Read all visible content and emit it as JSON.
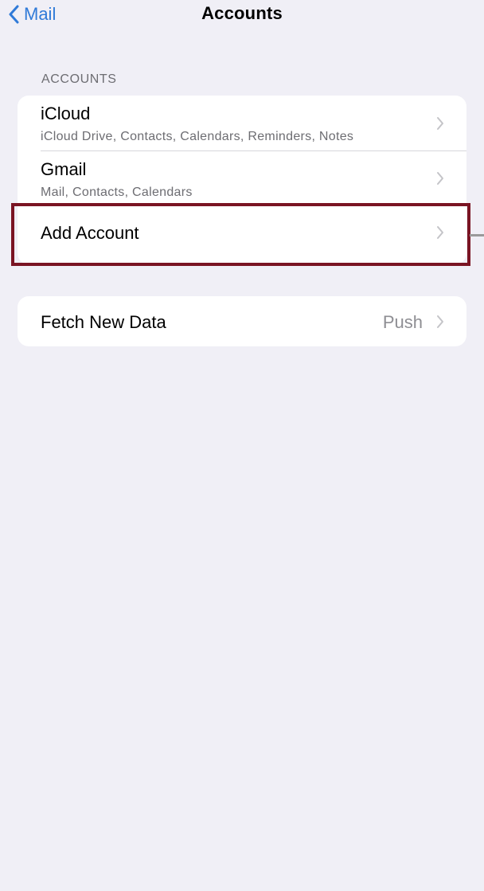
{
  "nav": {
    "back_label": "Mail",
    "title": "Accounts"
  },
  "accounts_section": {
    "header": "ACCOUNTS",
    "items": [
      {
        "title": "iCloud",
        "subtitle": "iCloud Drive, Contacts, Calendars, Reminders, Notes"
      },
      {
        "title": "Gmail",
        "subtitle": "Mail, Contacts, Calendars"
      },
      {
        "title": "Add Account"
      }
    ]
  },
  "fetch_section": {
    "title": "Fetch New Data",
    "value": "Push"
  },
  "icons": {
    "back": "chevron-left-icon",
    "disclosure": "chevron-right-icon"
  },
  "colors": {
    "accent": "#2f7ad8",
    "highlight": "#7a1423",
    "background": "#f0eff6"
  }
}
